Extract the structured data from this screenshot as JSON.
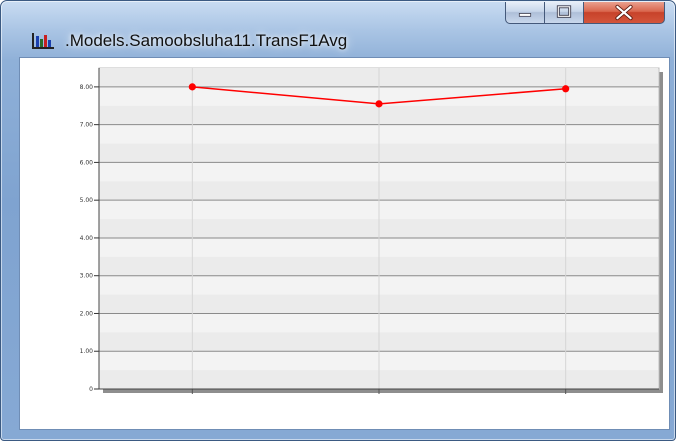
{
  "window": {
    "title": ".Models.Samoobsluha11.TransF1Avg"
  },
  "icons": {
    "app": "bar-chart-icon",
    "minimize": "minimize-icon",
    "maximize": "maximize-icon",
    "close": "close-icon"
  },
  "colors": {
    "series": "#ff0000",
    "close_button": "#c7422a"
  },
  "chart_data": {
    "type": "line",
    "title": "",
    "xlabel": "",
    "ylabel": "",
    "ylim": [
      0,
      8.5
    ],
    "yticks": [
      0,
      1,
      2,
      3,
      4,
      5,
      6,
      7,
      8
    ],
    "ytick_labels": [
      "0",
      "1.00",
      "2.00",
      "3.00",
      "4.00",
      "5.00",
      "6.00",
      "7.00",
      "8.00"
    ],
    "x": [
      1,
      2,
      3
    ],
    "series": [
      {
        "values": [
          8.0,
          7.55,
          7.95
        ],
        "color": "#ff0000"
      }
    ],
    "grid": true,
    "legend": "none"
  }
}
